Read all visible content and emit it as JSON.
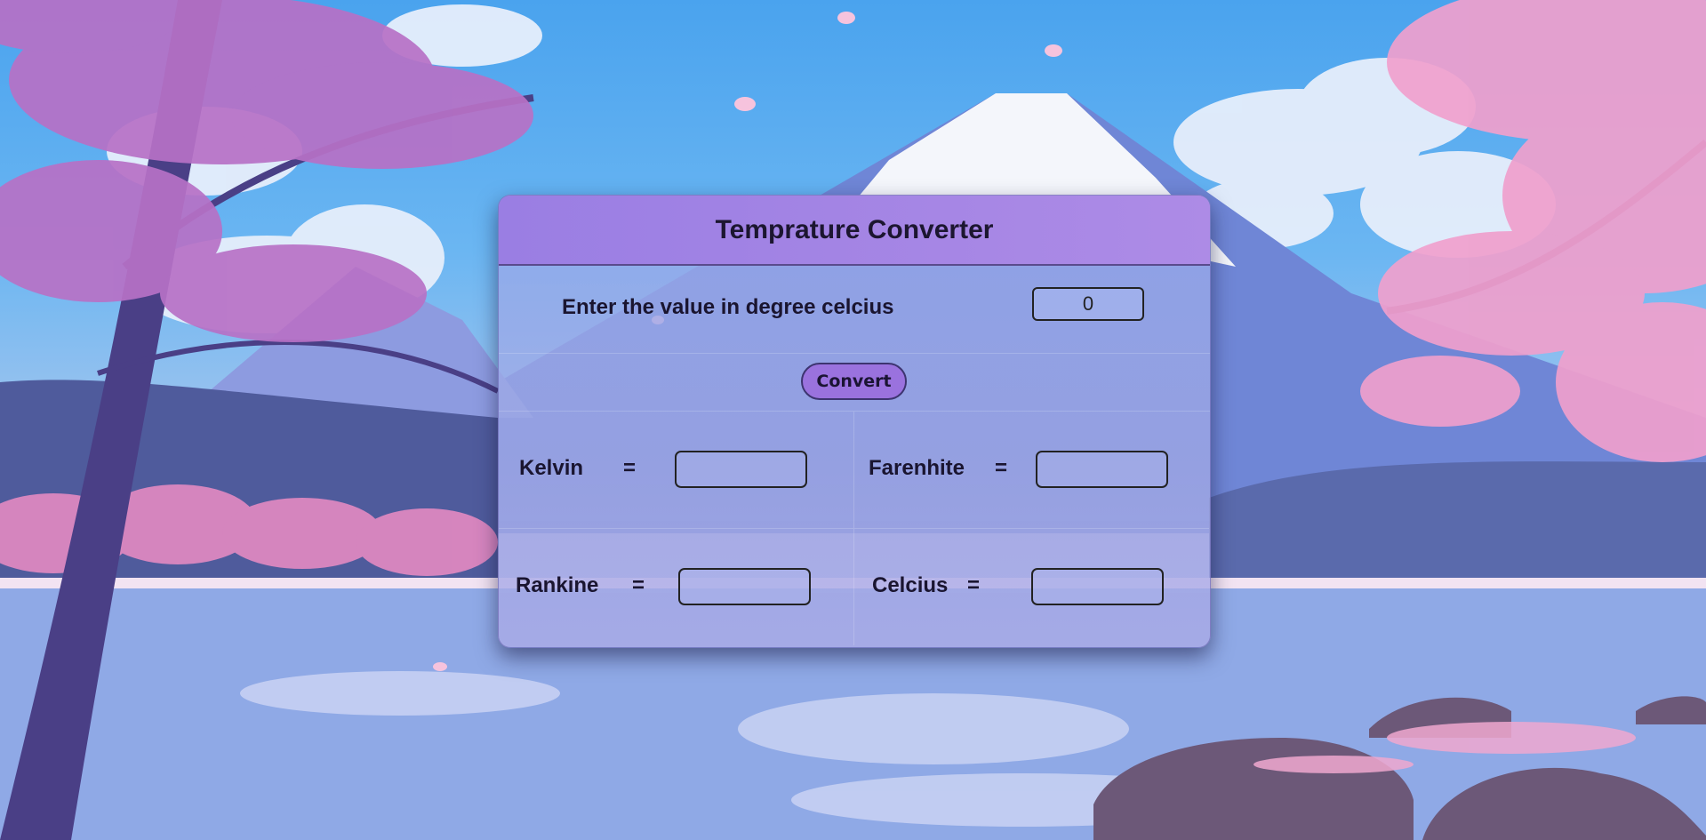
{
  "app": {
    "title": "Temprature Converter"
  },
  "input_row": {
    "label": "Enter the value in degree celcius",
    "value": "0"
  },
  "convert_button": {
    "label": "Convert"
  },
  "results": {
    "kelvin": {
      "label": "Kelvin",
      "equals": "=",
      "value": ""
    },
    "farenhite": {
      "label": "Farenhite",
      "equals": "=",
      "value": ""
    },
    "rankine": {
      "label": "Rankine",
      "equals": "=",
      "value": ""
    },
    "celcius": {
      "label": "Celcius",
      "equals": "=",
      "value": ""
    }
  },
  "colors": {
    "header": "#9a7ee3",
    "button": "#9a72de",
    "text": "#1a1530"
  }
}
